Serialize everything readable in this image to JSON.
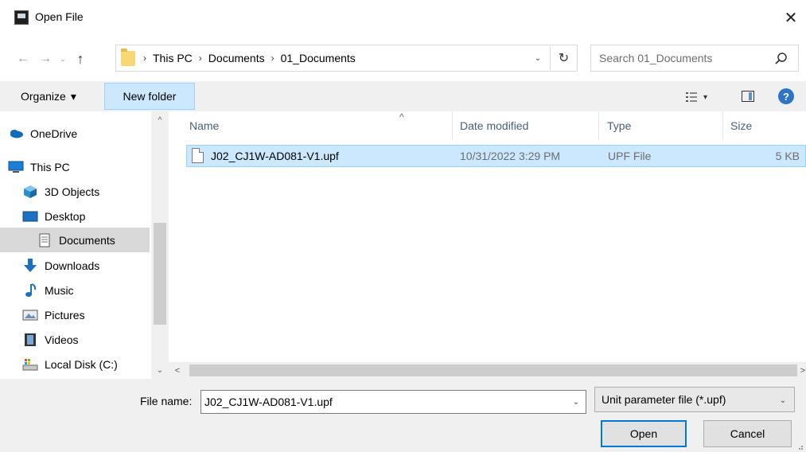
{
  "window": {
    "title": "Open File",
    "close_glyph": "✕"
  },
  "nav": {
    "back_glyph": "←",
    "forward_glyph": "→",
    "recent_glyph": "⌄",
    "up_glyph": "↑",
    "breadcrumb": [
      "This PC",
      "Documents",
      "01_Documents"
    ],
    "breadcrumb_sep": "›",
    "dropdown_glyph": "⌄",
    "refresh_glyph": "↻"
  },
  "search": {
    "placeholder": "Search 01_Documents",
    "value": ""
  },
  "toolbar": {
    "organize_label": "Organize",
    "organize_caret": "▾",
    "new_folder_label": "New folder",
    "view_caret": "▾",
    "help_label": "?"
  },
  "sidebar": {
    "items": [
      {
        "label": "OneDrive",
        "icon": "onedrive-icon"
      },
      {
        "label": "This PC",
        "icon": "this-pc-icon"
      },
      {
        "label": "3D Objects",
        "icon": "3d-objects-icon"
      },
      {
        "label": "Desktop",
        "icon": "desktop-icon"
      },
      {
        "label": "Documents",
        "icon": "documents-icon",
        "selected": true
      },
      {
        "label": "Downloads",
        "icon": "downloads-icon"
      },
      {
        "label": "Music",
        "icon": "music-icon"
      },
      {
        "label": "Pictures",
        "icon": "pictures-icon"
      },
      {
        "label": "Videos",
        "icon": "videos-icon"
      },
      {
        "label": "Local Disk (C:)",
        "icon": "local-disk-icon"
      }
    ],
    "scroll_up_glyph": "^",
    "scroll_down_glyph": "⌄"
  },
  "file_list": {
    "columns": [
      "Name",
      "Date modified",
      "Type",
      "Size"
    ],
    "sort_glyph": "^",
    "rows": [
      {
        "name": "J02_CJ1W-AD081-V1.upf",
        "date_modified": "10/31/2022 3:29 PM",
        "type": "UPF File",
        "size": "5 KB",
        "selected": true
      }
    ],
    "scroll_left_glyph": "<",
    "scroll_right_glyph": ">"
  },
  "footer": {
    "file_name_label": "File name:",
    "file_name_value": "J02_CJ1W-AD081-V1.upf",
    "file_name_dd_glyph": "⌄",
    "file_type_value": "Unit parameter file (*.upf)",
    "file_type_dd_glyph": "⌄",
    "open_label": "Open",
    "cancel_label": "Cancel"
  },
  "colors": {
    "selection_bg": "#cce8ff",
    "selection_border": "#99d1ff",
    "header_text": "#4c607a",
    "accent": "#0078d7"
  }
}
